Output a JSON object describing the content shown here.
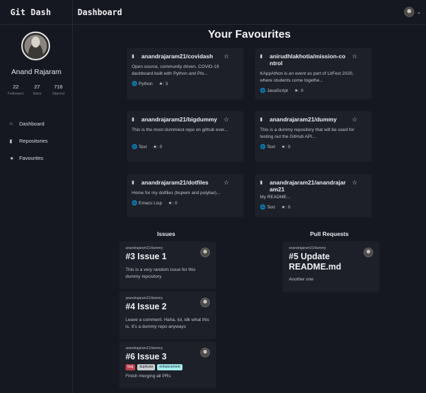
{
  "app": {
    "brand": "Git Dash",
    "page_title": "Dashboard"
  },
  "profile": {
    "name": "Anand Rajaram",
    "stats": [
      {
        "value": "22",
        "label": "Followers"
      },
      {
        "value": "27",
        "label": "Stars"
      },
      {
        "value": "716",
        "label": "Starred"
      }
    ]
  },
  "nav": [
    {
      "icon": "home-icon",
      "label": "Dashboard"
    },
    {
      "icon": "book-icon",
      "label": "Repositories"
    },
    {
      "icon": "star-icon",
      "label": "Favourites"
    }
  ],
  "favourites": {
    "title": "Your Favourites",
    "repos": [
      {
        "name": "anandrajaram21/covidash",
        "desc": "Open source, community driven, COVID-19 dashboard built with Python and Plo...",
        "lang": "Python",
        "stars": ": 3"
      },
      {
        "name": "anirudhlakhotia/mission-control",
        "desc": "KAppAthon is an event as part of LitFest 2020, where students come togethe...",
        "lang": "JavaScript",
        "stars": ": 0"
      },
      {
        "name": "anandrajaram21/bigdummy",
        "desc": "This is the most dummiest repo on github ever...",
        "lang": "Text",
        "stars": ": 0"
      },
      {
        "name": "anandrajaram21/dummy",
        "desc": "This is a dummy repository that will be used for testing out the GitHub API...",
        "lang": "Text",
        "stars": ": 0"
      },
      {
        "name": "anandrajaram21/dotfiles",
        "desc": "Home for my dotfiles (bspwm and polybar)...",
        "lang": "Emacs Lisp",
        "stars": ": 0"
      },
      {
        "name": "anandrajaram21/anandrajaram21",
        "desc": "My README...",
        "lang": "Text",
        "stars": ": 0"
      }
    ]
  },
  "issues": {
    "title": "Issues",
    "items": [
      {
        "repo": "anandrajaram21/dummy",
        "title": "#3 Issue 1",
        "body": "This is a very random issue for this dummy repository"
      },
      {
        "repo": "anandrajaram21/dummy",
        "title": "#4 Issue 2",
        "body": "Leave a comment. Haha, lol, idk what this is. It's a dummy repo anyways"
      },
      {
        "repo": "anandrajaram21/dummy",
        "title": "#6 Issue 3",
        "labels": [
          "bug",
          "duplicate",
          "enhancement"
        ],
        "body": "Finish merging all PRs"
      }
    ]
  },
  "pull_requests": {
    "title": "Pull Requests",
    "items": [
      {
        "repo": "anandrajaram21/dummy",
        "title": "#5 Update README.md",
        "body": "Another one"
      }
    ]
  },
  "colors": {
    "background": "#161821",
    "card": "#1d2029",
    "bug": "#c2414f",
    "duplicate": "#c9cbd1",
    "enhancement": "#a6ecec"
  }
}
